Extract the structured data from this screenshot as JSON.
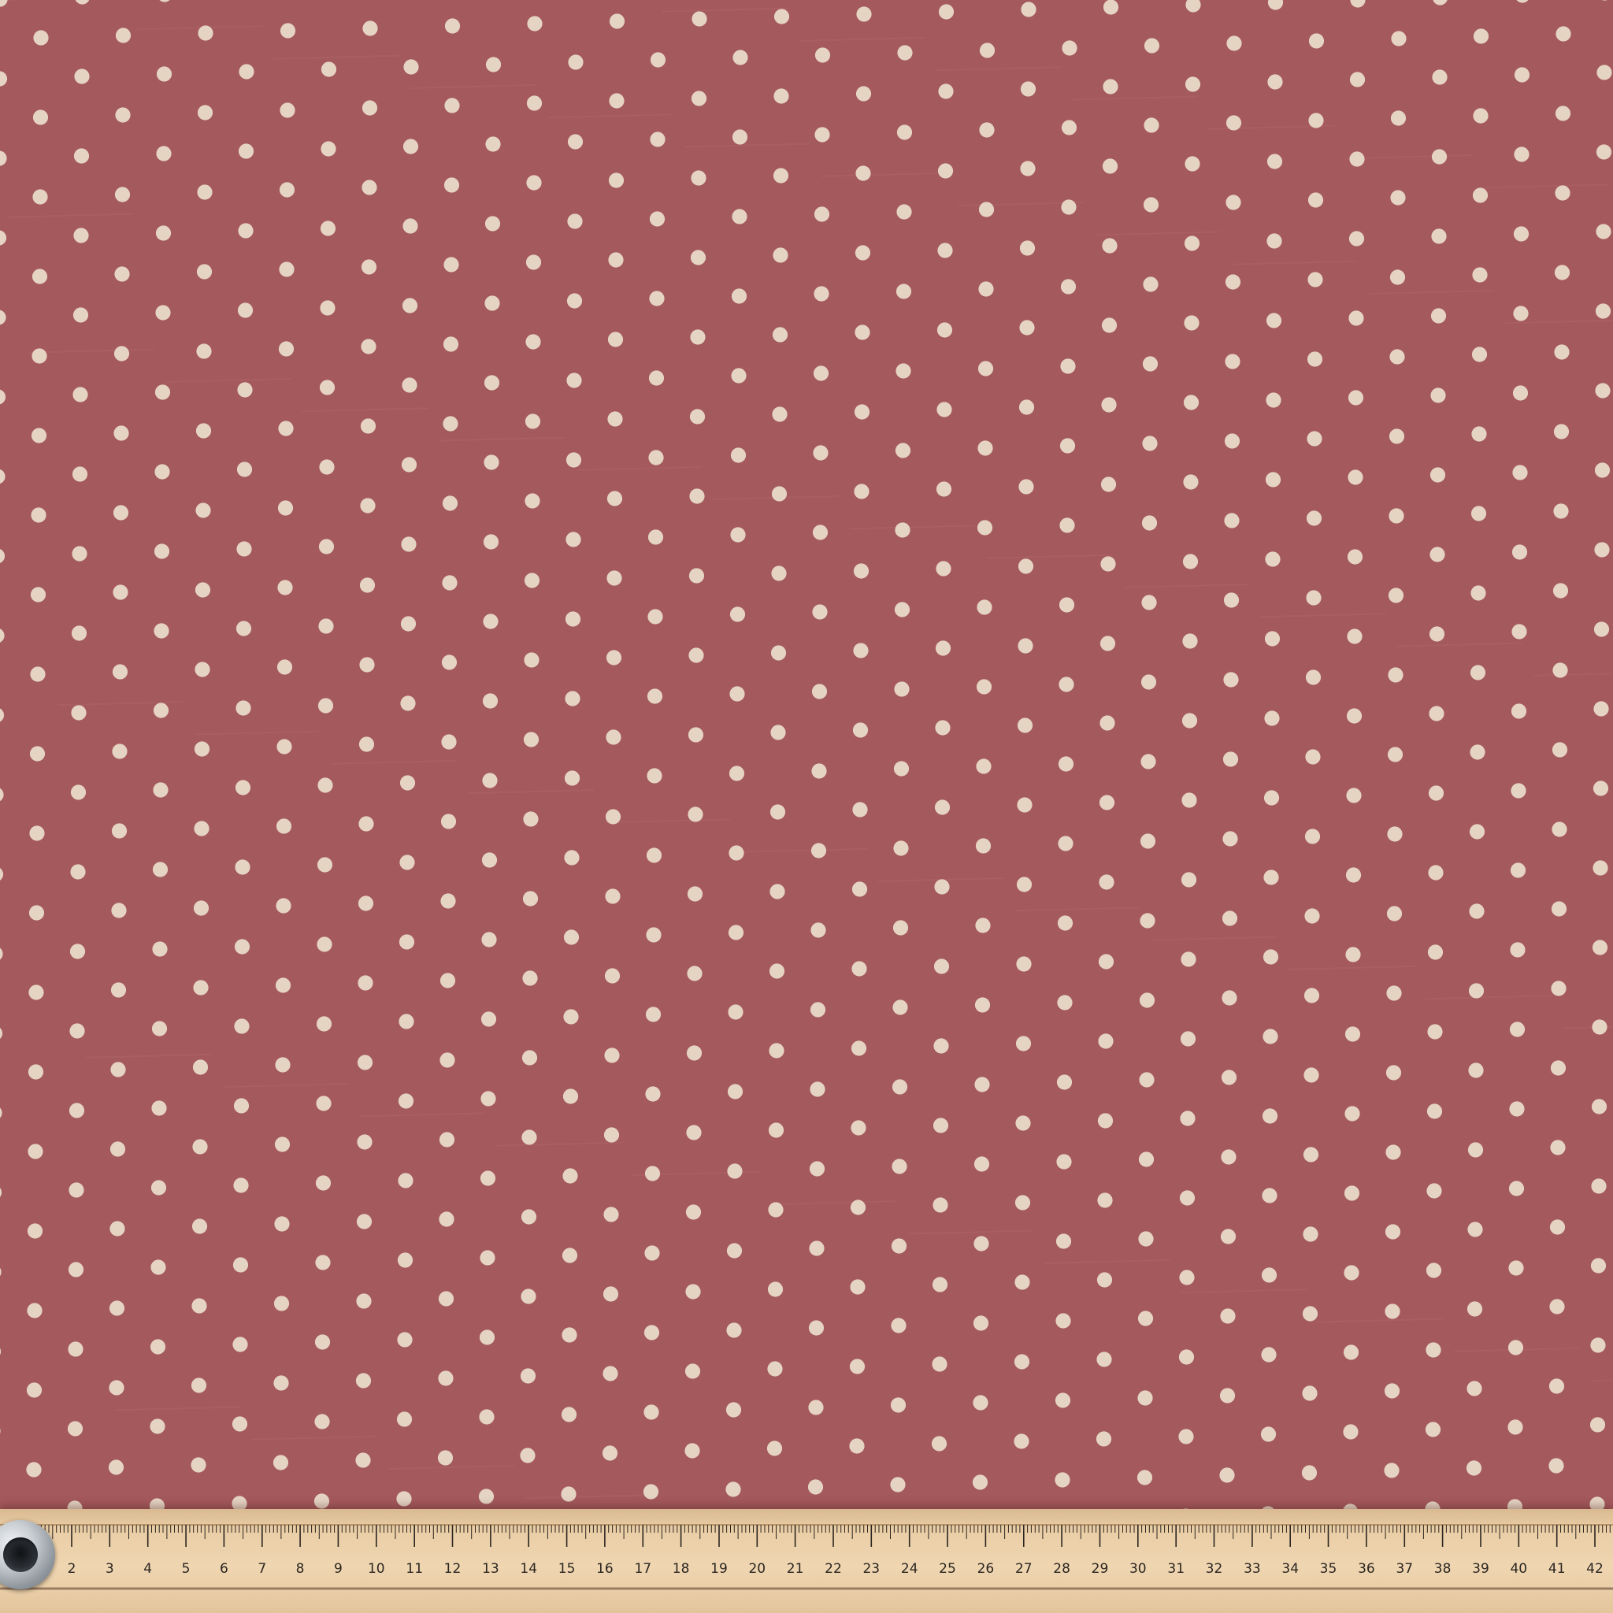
{
  "fabric": {
    "background_color": "#a4595c",
    "dot_color": "#e6d4c2",
    "pattern": "polka-dot"
  },
  "ruler": {
    "color": "#ecd2ac",
    "tick_color": "#2b2520",
    "numbers": [
      "2",
      "3",
      "4",
      "5",
      "6",
      "7",
      "8",
      "9",
      "10",
      "11",
      "12",
      "13",
      "14",
      "15",
      "16",
      "17",
      "18",
      "19",
      "20",
      "21",
      "22",
      "23",
      "24",
      "25",
      "26",
      "27",
      "28",
      "29",
      "30",
      "31",
      "32",
      "33",
      "34",
      "35",
      "36",
      "37",
      "38",
      "39",
      "40",
      "41",
      "42",
      "4"
    ]
  },
  "grommet": {
    "icon": "metal-grommet"
  }
}
